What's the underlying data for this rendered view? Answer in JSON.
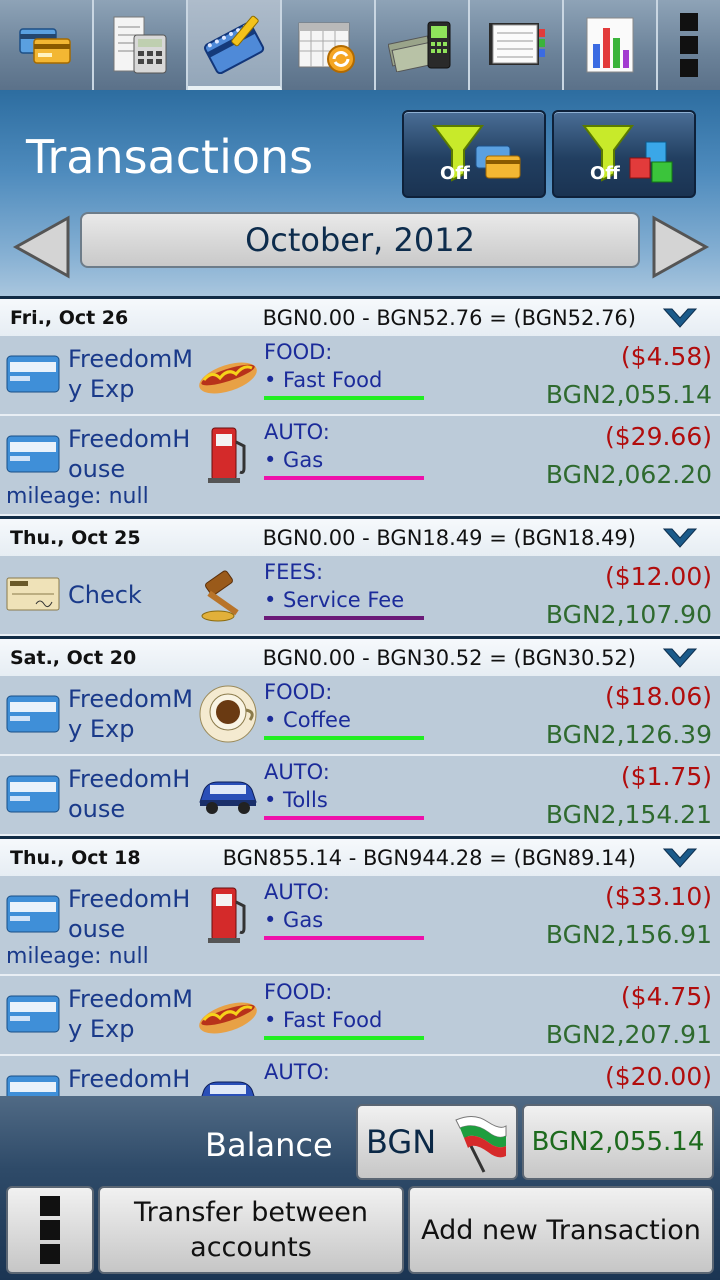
{
  "header": {
    "title": "Transactions",
    "filter_accounts_label": "Off",
    "filter_categories_label": "Off",
    "month": "October, 2012"
  },
  "toolbar": {
    "items": [
      "accounts-icon",
      "calculator-icon",
      "transactions-icon",
      "calendar-icon",
      "budget-icon",
      "reports-icon",
      "charts-icon",
      "more-icon"
    ]
  },
  "days": [
    {
      "date": "Fri., Oct 26",
      "summary": "BGN0.00 - BGN52.76 = (BGN52.76)",
      "items": [
        {
          "account": "FreedomM y Exp",
          "category": "FOOD:",
          "sub": "• Fast Food",
          "amount": "($4.58)",
          "balance": "BGN2,055.14",
          "line_color": "#22ee22",
          "icon": "hotdog-icon"
        },
        {
          "account": "FreedomH ouse",
          "category": "AUTO:",
          "sub": "• Gas",
          "amount": "($29.66)",
          "balance": "BGN2,062.20",
          "line_color": "#ee11aa",
          "icon": "gas-pump-icon",
          "note": "mileage: null"
        }
      ]
    },
    {
      "date": "Thu., Oct 25",
      "summary": "BGN0.00 - BGN18.49 = (BGN18.49)",
      "items": [
        {
          "account": "Check",
          "category": "FEES:",
          "sub": "• Service Fee",
          "amount": "($12.00)",
          "balance": "BGN2,107.90",
          "line_color": "#6b1a78",
          "icon": "gavel-icon"
        }
      ]
    },
    {
      "date": "Sat., Oct 20",
      "summary": "BGN0.00 - BGN30.52 = (BGN30.52)",
      "items": [
        {
          "account": "FreedomM y Exp",
          "category": "FOOD:",
          "sub": "• Coffee",
          "amount": "($18.06)",
          "balance": "BGN2,126.39",
          "line_color": "#22ee22",
          "icon": "coffee-icon"
        },
        {
          "account": "FreedomH ouse",
          "category": "AUTO:",
          "sub": "• Tolls",
          "amount": "($1.75)",
          "balance": "BGN2,154.21",
          "line_color": "#ee11aa",
          "icon": "car-icon"
        }
      ]
    },
    {
      "date": "Thu., Oct 18",
      "summary": "BGN855.14 - BGN944.28 = (BGN89.14)",
      "items": [
        {
          "account": "FreedomH ouse",
          "category": "AUTO:",
          "sub": "• Gas",
          "amount": "($33.10)",
          "balance": "BGN2,156.91",
          "line_color": "#ee11aa",
          "icon": "gas-pump-icon",
          "note": "mileage: null"
        },
        {
          "account": "FreedomM y Exp",
          "category": "FOOD:",
          "sub": "• Fast Food",
          "amount": "($4.75)",
          "balance": "BGN2,207.91",
          "line_color": "#22ee22",
          "icon": "hotdog-icon"
        },
        {
          "account": "FreedomH",
          "category": "AUTO:",
          "sub": "",
          "amount": "($20.00)",
          "balance": "",
          "line_color": "#ee11aa",
          "icon": "car-icon"
        }
      ]
    }
  ],
  "footer": {
    "balance_label": "Balance",
    "currency": "BGN",
    "total": "BGN2,055.14",
    "transfer_label": "Transfer between accounts",
    "add_label": "Add new Transaction"
  }
}
